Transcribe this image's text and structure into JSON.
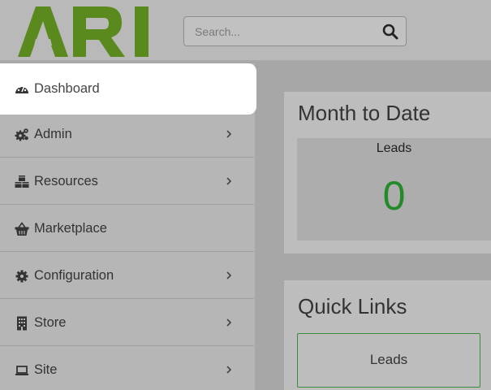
{
  "header": {
    "logo_text": "ARI",
    "brand_color": "#5a8a1e",
    "search": {
      "placeholder": "Search...",
      "value": ""
    }
  },
  "sidebar": {
    "items": [
      {
        "label": "Dashboard",
        "icon": "dashboard-gauge-icon",
        "active": true,
        "has_submenu": false
      },
      {
        "label": "Admin",
        "icon": "cogs-icon",
        "active": false,
        "has_submenu": true
      },
      {
        "label": "Resources",
        "icon": "cubes-icon",
        "active": false,
        "has_submenu": true
      },
      {
        "label": "Marketplace",
        "icon": "basket-icon",
        "active": false,
        "has_submenu": false
      },
      {
        "label": "Configuration",
        "icon": "gear-icon",
        "active": false,
        "has_submenu": true
      },
      {
        "label": "Store",
        "icon": "building-icon",
        "active": false,
        "has_submenu": true
      },
      {
        "label": "Site",
        "icon": "laptop-icon",
        "active": false,
        "has_submenu": true
      }
    ]
  },
  "main": {
    "month_to_date": {
      "title": "Month to Date",
      "metric_label": "Leads",
      "metric_value": "0",
      "value_color": "#238a2c"
    },
    "quick_links": {
      "title": "Quick Links",
      "links": [
        "Leads"
      ]
    }
  }
}
